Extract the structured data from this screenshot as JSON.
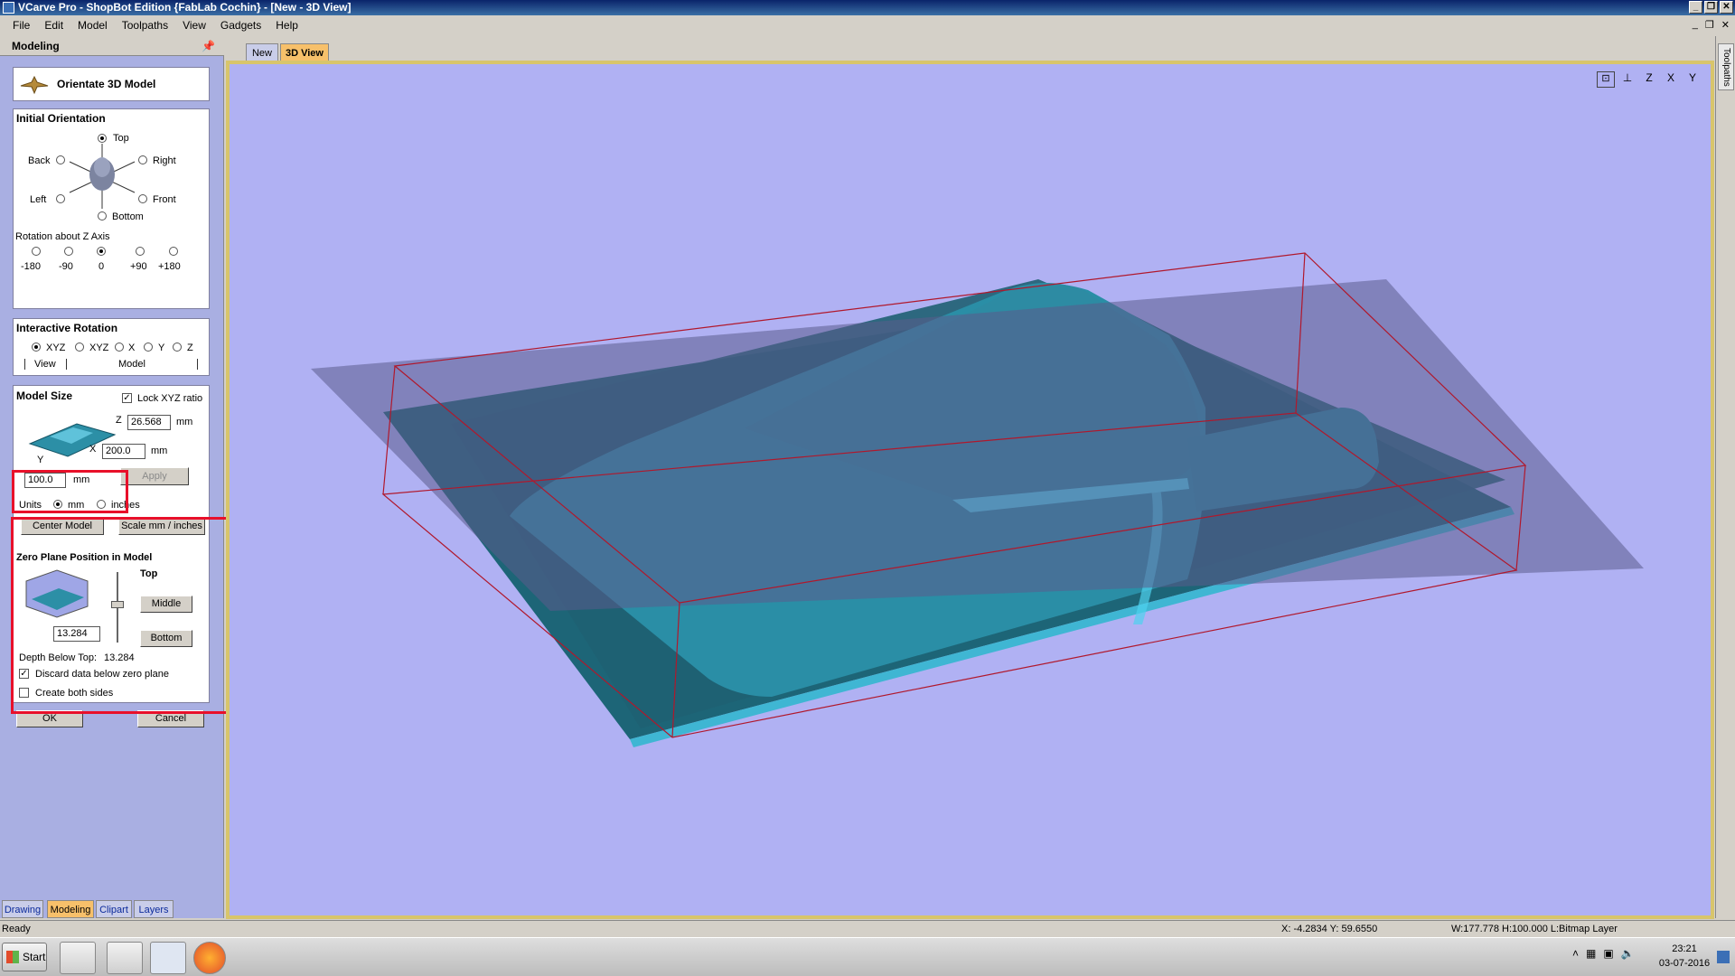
{
  "window": {
    "title": "VCarve Pro - ShopBot Edition {FabLab Cochin} - [New - 3D View]"
  },
  "menu": [
    "File",
    "Edit",
    "Model",
    "Toolpaths",
    "View",
    "Gadgets",
    "Help"
  ],
  "panel": {
    "title": "Modeling",
    "header_title": "Orientate 3D Model",
    "initial_orientation": {
      "title": "Initial Orientation",
      "top": "Top",
      "back": "Back",
      "right": "Right",
      "left": "Left",
      "front": "Front",
      "bottom": "Bottom",
      "z_axis_label": "Rotation about Z Axis",
      "z_options": [
        "-180",
        "-90",
        "0",
        "+90",
        "+180"
      ]
    },
    "interactive_rotation": {
      "title": "Interactive Rotation",
      "options": [
        "XYZ",
        "XYZ",
        "X",
        "Y",
        "Z"
      ],
      "view_label": "View",
      "model_label": "Model"
    },
    "model_size": {
      "title": "Model Size",
      "lock_label": "Lock XYZ ratio",
      "z_label": "Z",
      "z_value": "26.568",
      "z_unit": "mm",
      "x_label": "X",
      "x_value": "200.0",
      "x_unit": "mm",
      "y_label": "Y",
      "y_value": "100.0",
      "y_unit": "mm",
      "apply": "Apply",
      "units_label": "Units",
      "unit_mm": "mm",
      "unit_inches": "inches",
      "center_model": "Center Model",
      "scale_btn": "Scale mm / inches"
    },
    "zero_plane": {
      "title": "Zero Plane Position in Model",
      "top": "Top",
      "middle": "Middle",
      "bottom": "Bottom",
      "value": "13.284",
      "depth_label": "Depth Below Top:",
      "depth_value": "13.284",
      "discard_label": "Discard data below zero plane",
      "both_label": "Create both sides"
    },
    "ok": "OK",
    "cancel": "Cancel"
  },
  "left_tabs": [
    "Drawing",
    "Modeling",
    "Clipart",
    "Layers"
  ],
  "doc_tabs": [
    "New",
    "3D View"
  ],
  "right_tab": "Toolpaths",
  "view_icons": [
    "fit-view-icon",
    "iso-view-icon",
    "z-view-icon",
    "x-view-icon",
    "y-view-icon"
  ],
  "view_icon_labels": [
    "Z",
    "X",
    "Y"
  ],
  "status": {
    "ready": "Ready",
    "coords": "X: -4.2834 Y: 59.6550",
    "size": "W:177.778   H:100.000  L:Bitmap Layer"
  },
  "taskbar": {
    "start": "Start",
    "time": "23:21",
    "date": "03-07-2016"
  },
  "colors": {
    "panel_bg": "#a9afe2",
    "viewport_bg": "#b0b1f3",
    "model_teal": "#2c8fa6",
    "highlight_red": "#e8102a",
    "active_tab": "#f7c06a"
  }
}
